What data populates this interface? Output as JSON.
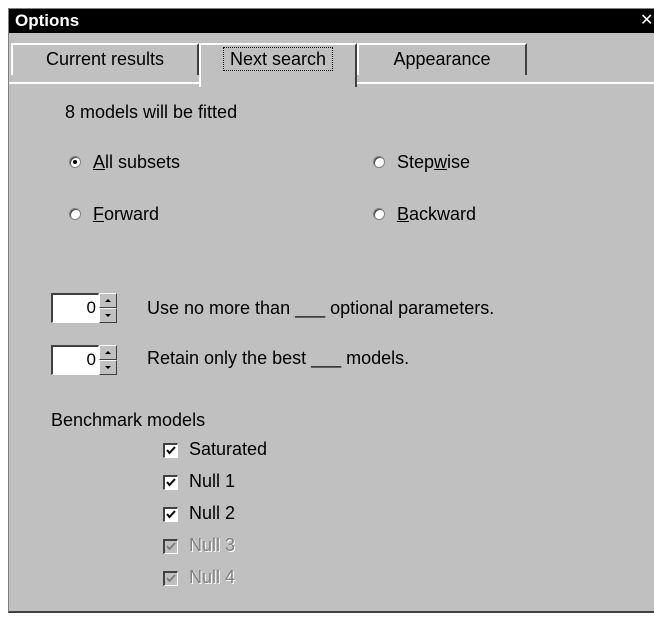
{
  "window": {
    "title": "Options",
    "close_glyph": "✕"
  },
  "tabs": [
    {
      "label": "Current results",
      "active": false
    },
    {
      "label": "Next search",
      "active": true
    },
    {
      "label": "Appearance",
      "active": false
    }
  ],
  "panel": {
    "models_info": "8 models will be fitted",
    "search_methods": [
      {
        "label": "All subsets",
        "accel": "A",
        "checked": true
      },
      {
        "label": "Stepwise",
        "accel": "w",
        "checked": false
      },
      {
        "label": "Forward",
        "accel": "F",
        "checked": false
      },
      {
        "label": "Backward",
        "accel": "B",
        "checked": false
      }
    ],
    "max_optional": {
      "value": "0",
      "label": "Use no more than ___ optional parameters."
    },
    "retain_best": {
      "value": "0",
      "label": "Retain only the best ___ models."
    },
    "benchmark_heading": "Benchmark models",
    "benchmarks": [
      {
        "label": "Saturated",
        "checked": true,
        "enabled": true
      },
      {
        "label": "Null 1",
        "checked": true,
        "enabled": true
      },
      {
        "label": "Null 2",
        "checked": true,
        "enabled": true
      },
      {
        "label": "Null 3",
        "checked": true,
        "enabled": false
      },
      {
        "label": "Null 4",
        "checked": true,
        "enabled": false
      }
    ]
  }
}
